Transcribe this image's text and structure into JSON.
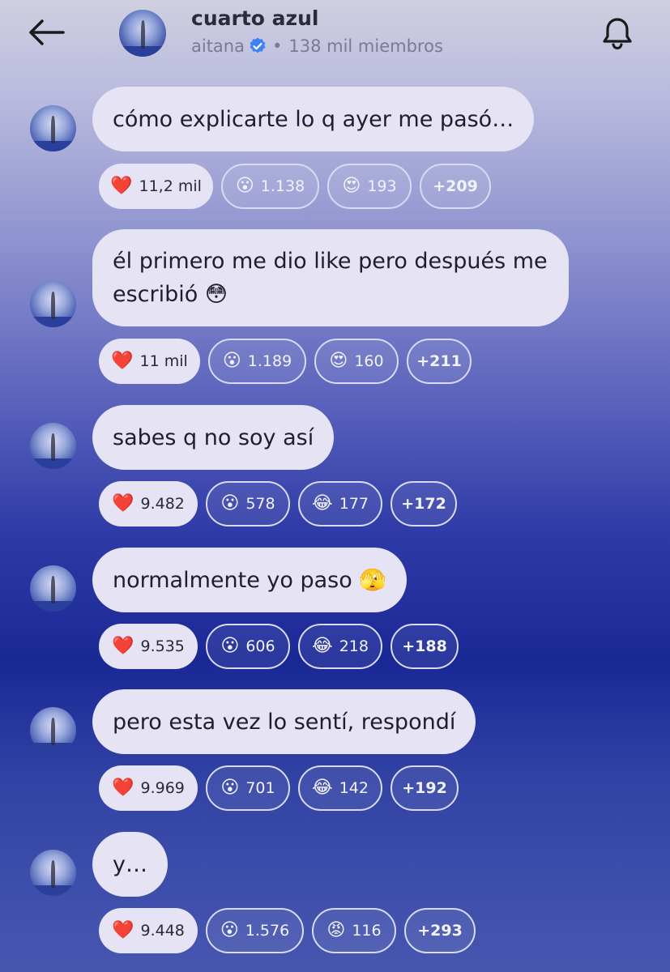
{
  "header": {
    "title": "cuarto azul",
    "author": "aitana",
    "members": "138 mil miembros",
    "separator": "•"
  },
  "messages": [
    {
      "text": "cómo explicarte lo q ayer me pasó…",
      "reactions": [
        {
          "emoji": "❤️",
          "count": "11,2 mil"
        },
        {
          "emoji": "😮",
          "count": "1.138"
        },
        {
          "emoji": "😍",
          "count": "193"
        }
      ],
      "more": "+209"
    },
    {
      "text": "él primero me dio like pero después me escribió 😳",
      "reactions": [
        {
          "emoji": "❤️",
          "count": "11 mil"
        },
        {
          "emoji": "😮",
          "count": "1.189"
        },
        {
          "emoji": "😍",
          "count": "160"
        }
      ],
      "more": "+211"
    },
    {
      "text": "sabes q no soy así",
      "reactions": [
        {
          "emoji": "❤️",
          "count": "9.482"
        },
        {
          "emoji": "😮",
          "count": "578"
        },
        {
          "emoji": "😂",
          "count": "177"
        }
      ],
      "more": "+172"
    },
    {
      "text": "normalmente yo paso 🫣",
      "reactions": [
        {
          "emoji": "❤️",
          "count": "9.535"
        },
        {
          "emoji": "😮",
          "count": "606"
        },
        {
          "emoji": "😂",
          "count": "218"
        }
      ],
      "more": "+188"
    },
    {
      "text": "pero esta vez lo sentí, respondí",
      "reactions": [
        {
          "emoji": "❤️",
          "count": "9.969"
        },
        {
          "emoji": "😮",
          "count": "701"
        },
        {
          "emoji": "😂",
          "count": "142"
        }
      ],
      "more": "+192"
    },
    {
      "text": "y…",
      "reactions": [
        {
          "emoji": "❤️",
          "count": "9.448"
        },
        {
          "emoji": "😮",
          "count": "1.576"
        },
        {
          "emoji": "😡",
          "count": "116"
        }
      ],
      "more": "+293"
    }
  ],
  "icons": {
    "back": "arrow-left-icon",
    "bell": "bell-icon",
    "verified": "verified-badge-icon"
  },
  "colors": {
    "bubble": "#e6e4f4",
    "verified": "#3b82f6"
  }
}
